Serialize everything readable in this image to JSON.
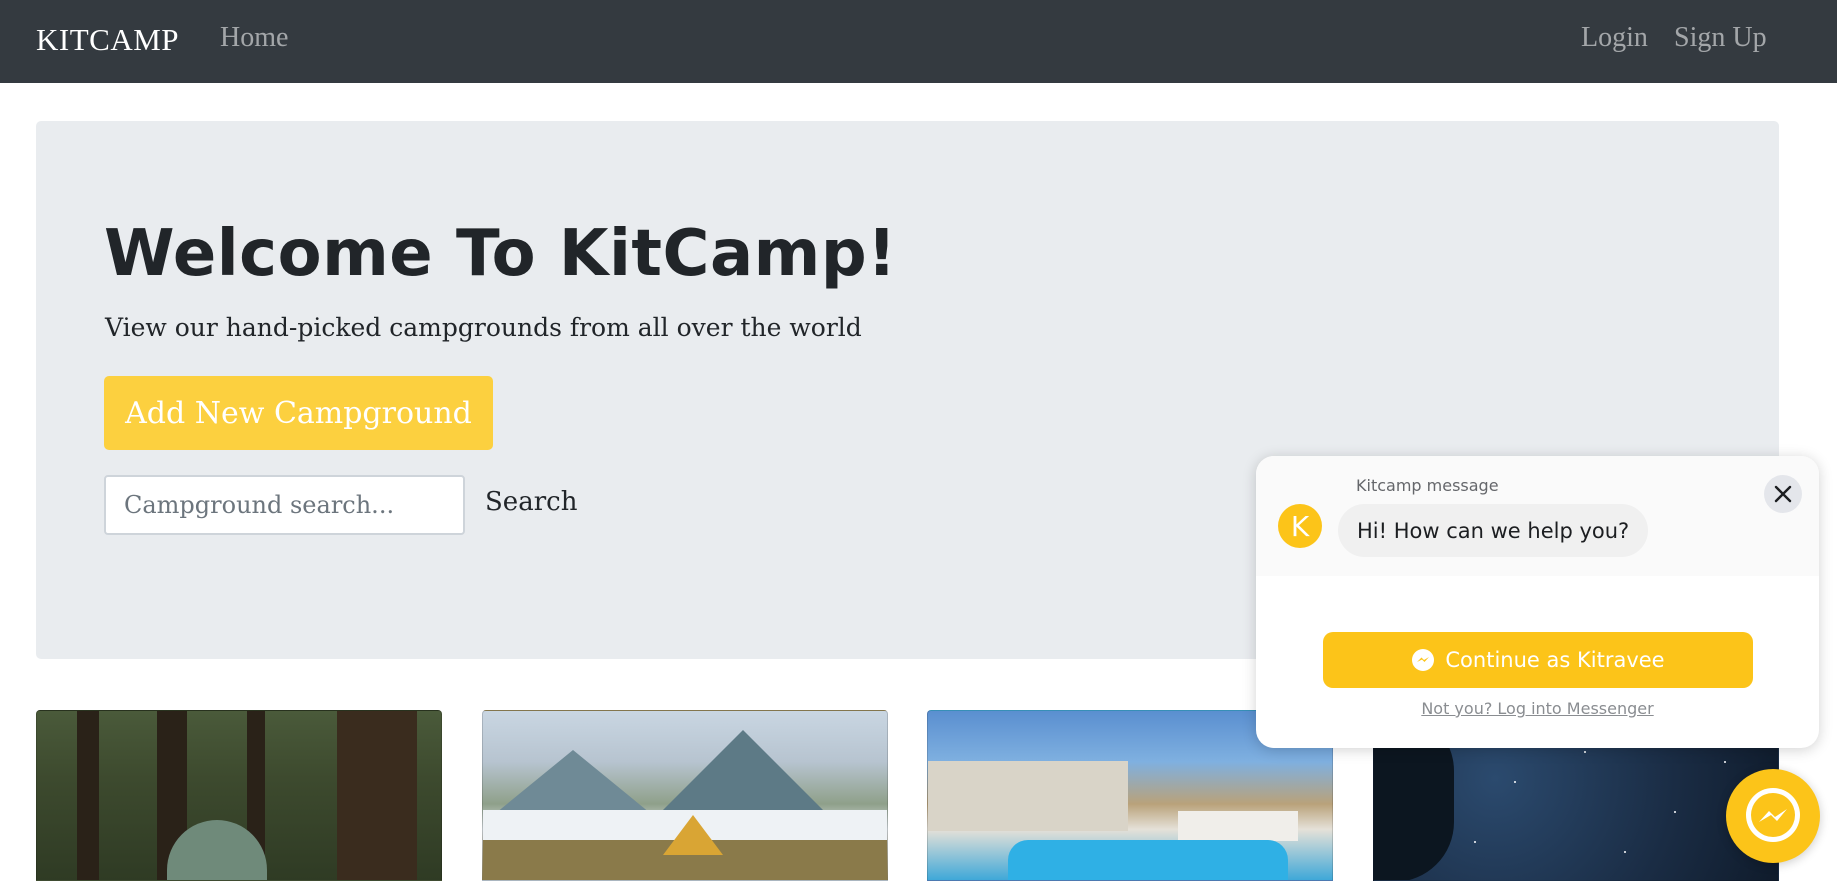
{
  "navbar": {
    "brand": "KITCAMP",
    "home": "Home",
    "login": "Login",
    "signup": "Sign Up"
  },
  "jumbotron": {
    "title": "Welcome To KitCamp!",
    "subtitle": "View our hand-picked campgrounds from all over the world",
    "add_button": "Add New Campground",
    "search_placeholder": "Campground search...",
    "search_button": "Search"
  },
  "cards": [
    {
      "image": "forest-camp-image"
    },
    {
      "image": "mountain-tent-image"
    },
    {
      "image": "resort-pool-image"
    },
    {
      "image": "night-sky-image"
    }
  ],
  "chat": {
    "sender": "Kitcamp message",
    "avatar_letter": "K",
    "greeting": "Hi! How can we help you?",
    "continue_button": "Continue as Kitravee",
    "not_you_link": "Not you? Log into Messenger"
  },
  "colors": {
    "navbar": "#343a40",
    "jumbotron": "#e9ecef",
    "accent": "#fcd03f",
    "messenger_accent": "#fcc419"
  }
}
